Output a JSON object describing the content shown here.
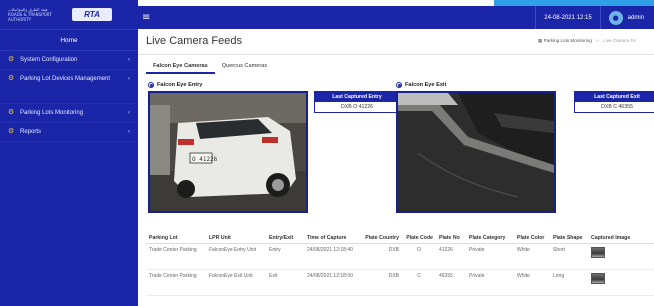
{
  "sidebar": {
    "brand_text": "ﻫﻴﺌﺔ ﺍﻟﻄﺮﻕ ﻭﺍﻟﻤﻮﺍﺻﻼﺕ ROADS & TRANSPORT AUTHORITY",
    "logo": "RTA",
    "home": "Home",
    "items": [
      {
        "label": "System Configuration",
        "icon": "gear-icon"
      },
      {
        "label": "Parking Lot Devices Management",
        "icon": "gear-icon"
      },
      {
        "label": "Parking Lots Monitoring",
        "icon": "gear-icon"
      },
      {
        "label": "Reports",
        "icon": "gear-icon"
      }
    ]
  },
  "header": {
    "menu_icon": "≡",
    "datetime": "24-08-2021 12:15",
    "user": "admin"
  },
  "page": {
    "title": "Live Camera Feeds",
    "breadcrumb": [
      "Parking Lots Monitoring",
      "Live Camera Fe"
    ]
  },
  "tabs": [
    {
      "label": "Falcon Eye Cameras",
      "active": true
    },
    {
      "label": "Quercus Cameras",
      "active": false
    }
  ],
  "entry": {
    "title": "Falcon Eye Entry",
    "last_label": "Last Captured Entry",
    "last_value": "DXB O 41226"
  },
  "exit": {
    "title": "Falcon Eye Exit",
    "last_label": "Last Captured Exit",
    "last_value": "DXB C 46355"
  },
  "table": {
    "headers": [
      "Parking Lot",
      "LPR Unit",
      "Entry/Exit",
      "Time of Capture",
      "Plate Country",
      "Plate Code",
      "Plate No",
      "Plate Category",
      "Plate Color",
      "Plate Shape",
      "Captured Image"
    ],
    "rows": [
      [
        "Trade Center Parking",
        "FalconEye Entry Unit",
        "Entry",
        "24/08/2021 12:18:40",
        "DXB",
        "O",
        "41226",
        "Private",
        "White",
        "Short",
        ""
      ],
      [
        "Trade Center Parking",
        "FalconEye Exit Unit",
        "Exit",
        "24/08/2021 12:18:00",
        "DXB",
        "C",
        "46355",
        "Private",
        "White",
        "Long",
        ""
      ]
    ]
  },
  "colors": {
    "primary": "#1a25a8",
    "accent": "#2fa0e8"
  }
}
